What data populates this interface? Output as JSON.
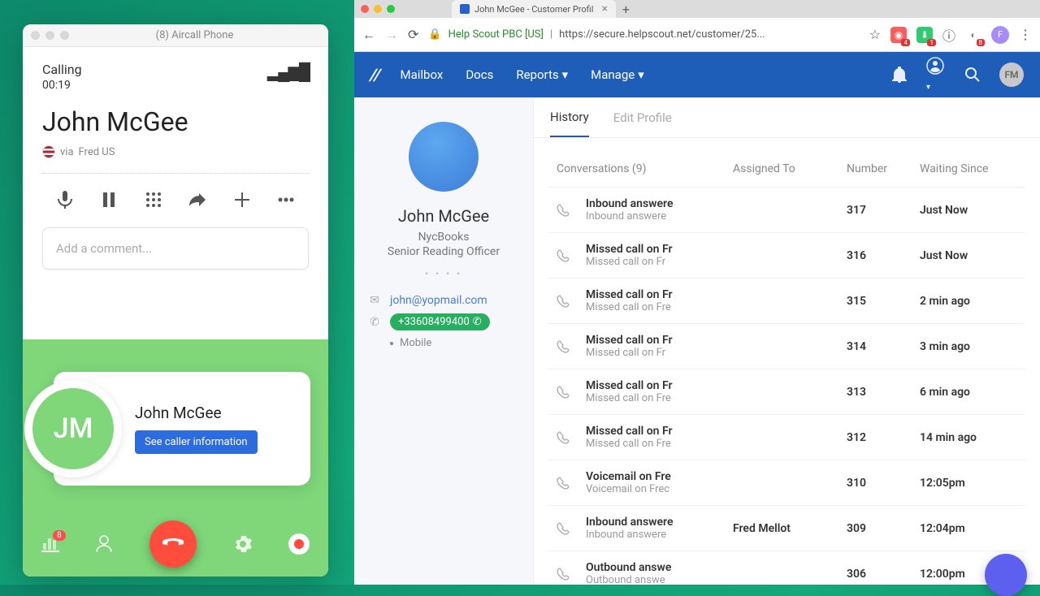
{
  "aircall": {
    "window_title": "(8) Aircall Phone",
    "calling_label": "Calling",
    "timer": "00:19",
    "caller_name": "John McGee",
    "via_label": "via",
    "via_line": "Fred US",
    "comment_placeholder": "Add a comment...",
    "card_name": "John McGee",
    "card_initials": "JM",
    "see_info_label": "See caller information",
    "badge_count": "8"
  },
  "browser": {
    "tab_title": "John McGee - Customer Profil",
    "url_org": "Help Scout PBC [US]",
    "url": "https://secure.helpscout.net/customer/25...",
    "avatar_letter": "F",
    "ext_badge_1": "4",
    "ext_badge_2": "1",
    "ext_badge_3": "8"
  },
  "helpscout": {
    "nav": {
      "mailbox": "Mailbox",
      "docs": "Docs",
      "reports": "Reports",
      "manage": "Manage"
    },
    "header_avatar": "FM",
    "profile": {
      "name": "John McGee",
      "company": "NycBooks",
      "title": "Senior Reading Officer",
      "email": "john@yopmail.com",
      "phone": "+33608499400",
      "phone_type": "Mobile"
    },
    "tabs": {
      "history": "History",
      "edit": "Edit Profile"
    },
    "table": {
      "header_conversations": "Conversations (9)",
      "header_assigned": "Assigned To",
      "header_number": "Number",
      "header_waiting": "Waiting Since",
      "rows": [
        {
          "title": "Inbound answere",
          "sub": "Inbound answere",
          "assigned": "",
          "number": "317",
          "waiting": "Just Now"
        },
        {
          "title": "Missed call on Fr",
          "sub": "Missed call on Fr",
          "assigned": "",
          "number": "316",
          "waiting": "Just Now"
        },
        {
          "title": "Missed call on Fr",
          "sub": "Missed call on Fre",
          "assigned": "",
          "number": "315",
          "waiting": "2 min ago"
        },
        {
          "title": "Missed call on Fr",
          "sub": "Missed call on Fr",
          "assigned": "",
          "number": "314",
          "waiting": "3 min ago"
        },
        {
          "title": "Missed call on Fr",
          "sub": "Missed call on Fre",
          "assigned": "",
          "number": "313",
          "waiting": "6 min ago"
        },
        {
          "title": "Missed call on Fr",
          "sub": "Missed call on Fre",
          "assigned": "",
          "number": "312",
          "waiting": "14 min ago"
        },
        {
          "title": "Voicemail on Fre",
          "sub": "Voicemail on Frec",
          "assigned": "",
          "number": "310",
          "waiting": "12:05pm"
        },
        {
          "title": "Inbound answere",
          "sub": "Inbound answere",
          "assigned": "Fred Mellot",
          "number": "309",
          "waiting": "12:04pm"
        },
        {
          "title": "Outbound answe",
          "sub": "Outbound answe",
          "assigned": "",
          "number": "306",
          "waiting": "12:00pm"
        }
      ]
    }
  }
}
